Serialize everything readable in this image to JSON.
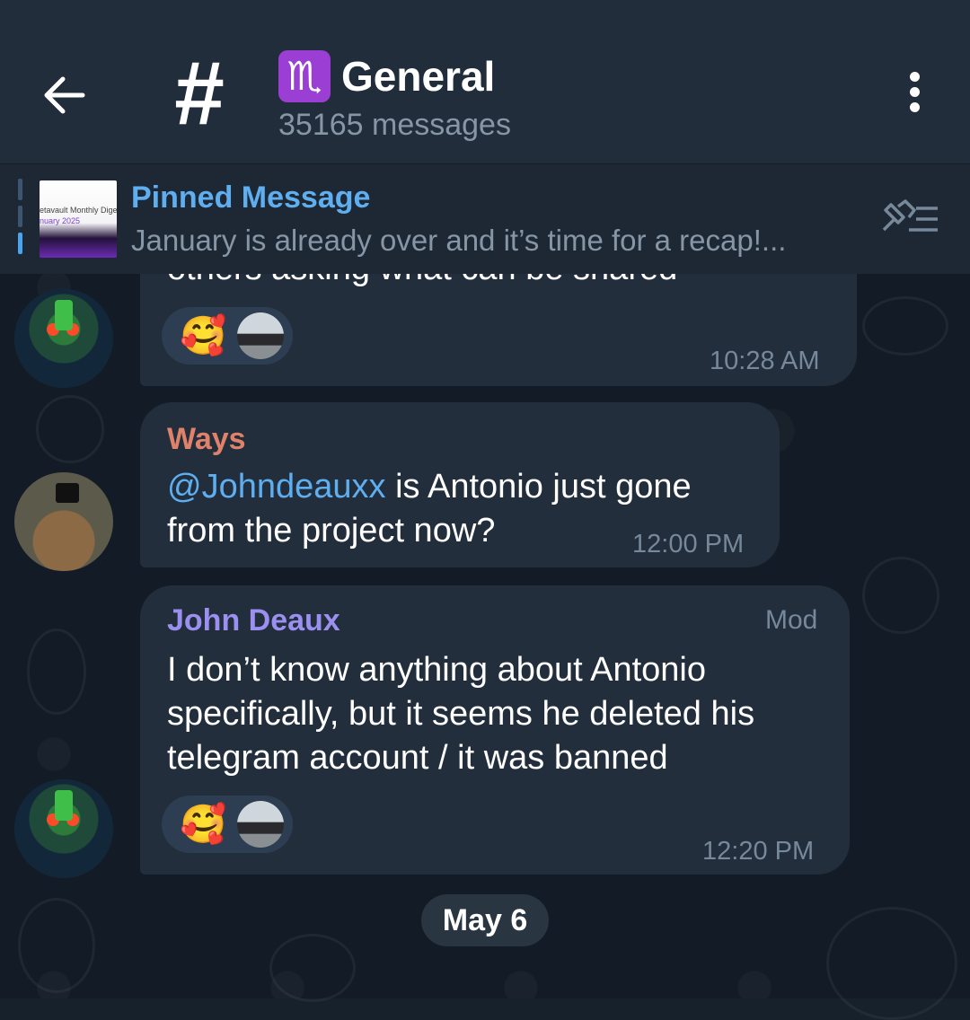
{
  "header": {
    "channel_icon": "#",
    "zodiac_icon": "♏",
    "title": "General",
    "subtitle": "35165 messages"
  },
  "pinned": {
    "label": "Pinned Message",
    "text": "January is already over and it’s time for a recap!...",
    "thumb_line1": "etavault Monthly Digest",
    "thumb_line2": "nuary 2025"
  },
  "messages": [
    {
      "partial_text": "others asking what can be shared",
      "reactions": [
        "🥰"
      ],
      "time": "10:28 AM"
    },
    {
      "sender": "Ways",
      "sender_color": "#e0826a",
      "mention": "@Johndeauxx",
      "text": " is Antonio just gone from the project now?",
      "time": "12:00 PM"
    },
    {
      "sender": "John Deaux",
      "sender_color": "#9b8ff0",
      "badge": "Mod",
      "text_lines": [
        "I don’t know anything about Antonio",
        "specifically, but it seems he deleted his",
        "telegram account / it was banned"
      ],
      "reactions": [
        "🥰"
      ],
      "time": "12:20 PM"
    }
  ],
  "date_separator": "May 6"
}
